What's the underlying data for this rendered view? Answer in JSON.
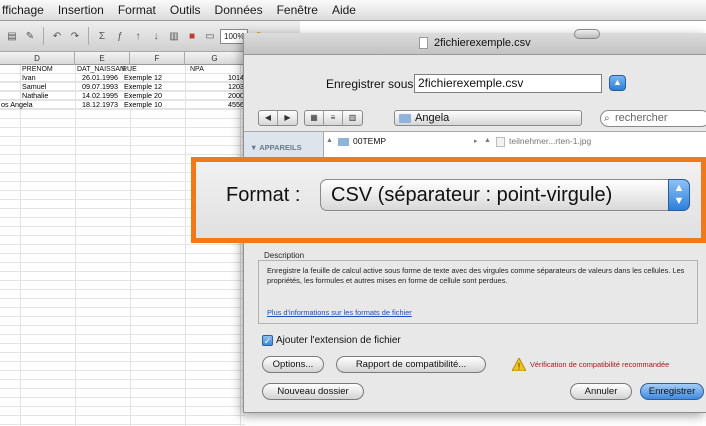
{
  "menu": [
    "ffichage",
    "Insertion",
    "Format",
    "Outils",
    "Données",
    "Fenêtre",
    "Aide"
  ],
  "toolbar": {
    "zoom": "100%"
  },
  "sheet": {
    "columns": [
      "D",
      "E",
      "F",
      "G"
    ],
    "header": [
      "PRENOM",
      "DAT_NAISSAN",
      "RUE",
      "NPA"
    ],
    "rows": [
      [
        "Ivan",
        "26.01.1996",
        "Exemple 12",
        "1014"
      ],
      [
        "Samuel",
        "09.07.1993",
        "Exemple 12",
        "1203"
      ],
      [
        "Nathalie",
        "14.02.1995",
        "Exemple 20",
        "2000"
      ],
      [
        "os Angela",
        "18.12.1973",
        "Exemple 10",
        "4556"
      ]
    ]
  },
  "dialog": {
    "title": "2fichierexemple.csv",
    "save_as_label": "Enregistrer sous :",
    "save_as_value": "2fichierexemple.csv",
    "folder": "Angela",
    "search_placeholder": "rechercher",
    "sidebar_section": "▼ APPAREILS",
    "browser_col1_item": "00TEMP",
    "browser_col2_item": "teilnehmer...rten-1.jpg",
    "description_label": "Description",
    "description_text": "Enregistre la feuille de calcul active sous forme de texte avec des virgules comme séparateurs de valeurs dans les cellules. Les propriétés, les formules et autres mises en forme de cellule sont perdues.",
    "description_link": "Plus d'informations sur les formats de fichier",
    "extension_checkbox_label": "Ajouter l'extension de fichier",
    "options_button": "Options...",
    "compat_button": "Rapport de compatibilité...",
    "warning_text": "Vérification de compatibilité recommandée",
    "new_folder_button": "Nouveau dossier",
    "cancel_button": "Annuler",
    "save_button": "Enregistrer"
  },
  "callout": {
    "format_label": "Format :",
    "format_value": "CSV (séparateur : point-virgule)"
  },
  "colors": {
    "callout_border": "#f07a1a",
    "accent_blue": "#3f8ae1",
    "warning_red": "#a31a1a"
  }
}
